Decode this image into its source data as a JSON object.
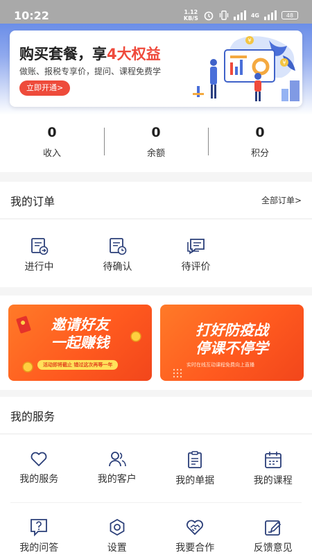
{
  "status_bar": {
    "time": "10:22",
    "speed_value": "1.12",
    "speed_unit": "KB/S",
    "signal_label": "4G",
    "battery": "48"
  },
  "promo": {
    "title_pre": "购买套餐，享",
    "title_highlight": "4大权益",
    "subtitle": "做账、报税专享价，提问、课程免费学",
    "button": "立即开通>"
  },
  "stats": [
    {
      "value": "0",
      "label": "收入"
    },
    {
      "value": "0",
      "label": "余额"
    },
    {
      "value": "0",
      "label": "积分"
    }
  ],
  "orders": {
    "title": "我的订单",
    "all_link": "全部订单>",
    "items": [
      {
        "label": "进行中",
        "icon": "order-in-progress-icon"
      },
      {
        "label": "待确认",
        "icon": "order-pending-icon"
      },
      {
        "label": "待评价",
        "icon": "order-review-icon"
      }
    ]
  },
  "banners": [
    {
      "title_line1": "邀请好友",
      "title_line2": "一起赚钱",
      "tag": "活动即将截止  错过这次再等一年"
    },
    {
      "title_line1": "打好防疫战",
      "title_line2": "停课不停学",
      "tag": "实时在线互动课程免费向上直播"
    }
  ],
  "services": {
    "title": "我的服务",
    "items": [
      {
        "label": "我的服务",
        "icon": "heart-icon"
      },
      {
        "label": "我的客户",
        "icon": "customers-icon"
      },
      {
        "label": "我的单据",
        "icon": "document-icon"
      },
      {
        "label": "我的课程",
        "icon": "calendar-icon"
      },
      {
        "label": "我的问答",
        "icon": "question-icon"
      },
      {
        "label": "设置",
        "icon": "settings-icon"
      },
      {
        "label": "我要合作",
        "icon": "handshake-icon"
      },
      {
        "label": "反馈意见",
        "icon": "feedback-icon"
      }
    ]
  },
  "colors": {
    "accent_red": "#ee4b3b",
    "banner_orange": "#ff6a24",
    "header_blue": "#6b8ee8"
  }
}
